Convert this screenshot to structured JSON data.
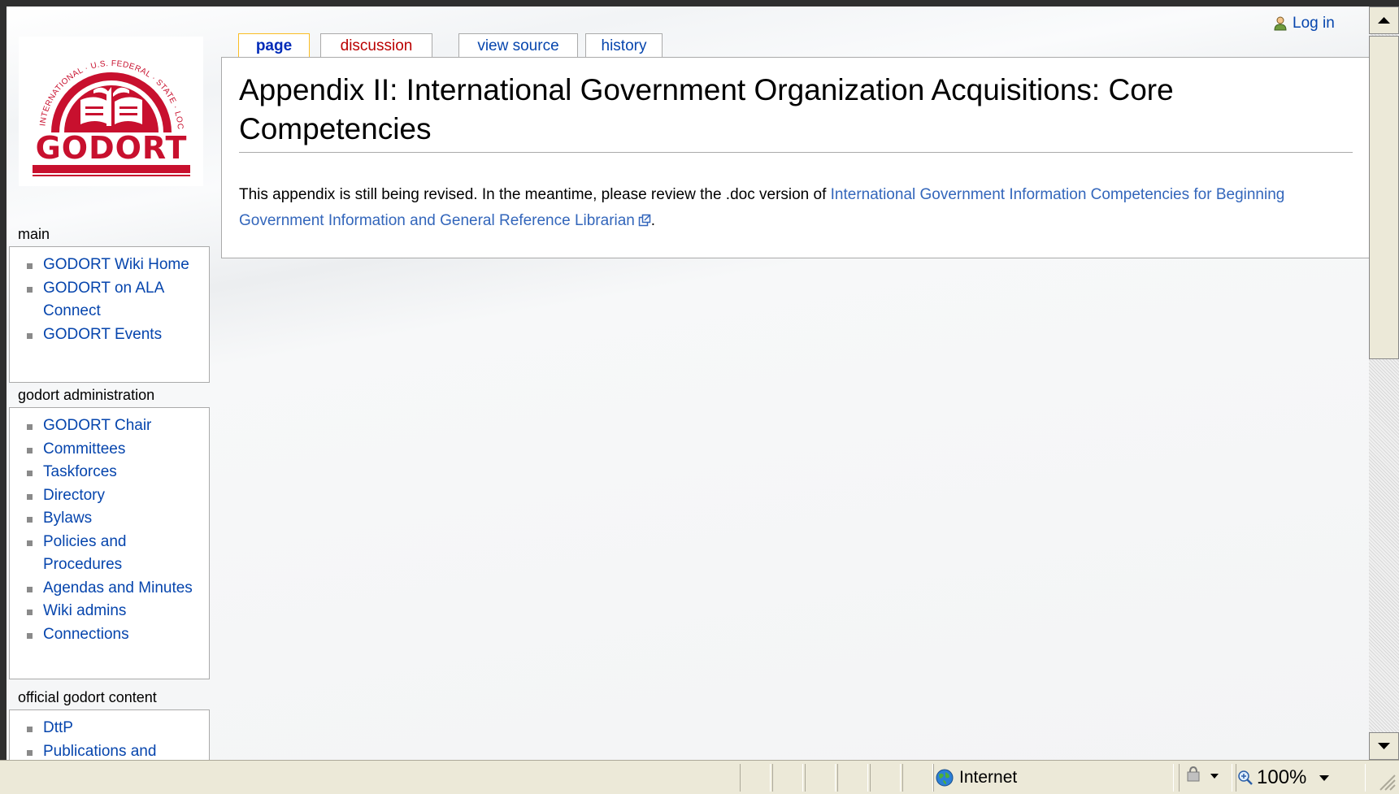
{
  "personal": {
    "login_label": "Log in"
  },
  "logo": {
    "text": "GODORT",
    "ring_text": "INTERNATIONAL · U.S. FEDERAL · STATE · LOCAL"
  },
  "tabs": [
    {
      "label": "page"
    },
    {
      "label": "discussion"
    },
    {
      "label": "view source"
    },
    {
      "label": "history"
    }
  ],
  "content": {
    "title": "Appendix II: International Government Organization Acquisitions: Core Competencies",
    "body_prefix": "This appendix is still being revised. In the meantime, please review the .doc version of ",
    "body_link": "International Government Information Competencies for Beginning Government Information and General Reference Librarian",
    "body_suffix": "."
  },
  "sidebar": {
    "main": {
      "title": "main",
      "items": [
        "GODORT Wiki Home",
        "GODORT on ALA Connect",
        "GODORT Events"
      ]
    },
    "admin": {
      "title": "godort administration",
      "items": [
        "GODORT Chair",
        "Committees",
        "Taskforces",
        "Directory",
        "Bylaws",
        "Policies and Procedures",
        "Agendas and Minutes",
        "Wiki admins",
        "Connections"
      ]
    },
    "official": {
      "title": "official godort content",
      "items": [
        "DttP",
        "Publications and"
      ]
    }
  },
  "statusbar": {
    "zone_label": "Internet",
    "zoom_label": "100%"
  },
  "colors": {
    "link": "#0645ad",
    "new_link": "#ba0000",
    "selected_tab_border": "#fabd23",
    "logo_red": "#c8102e"
  }
}
